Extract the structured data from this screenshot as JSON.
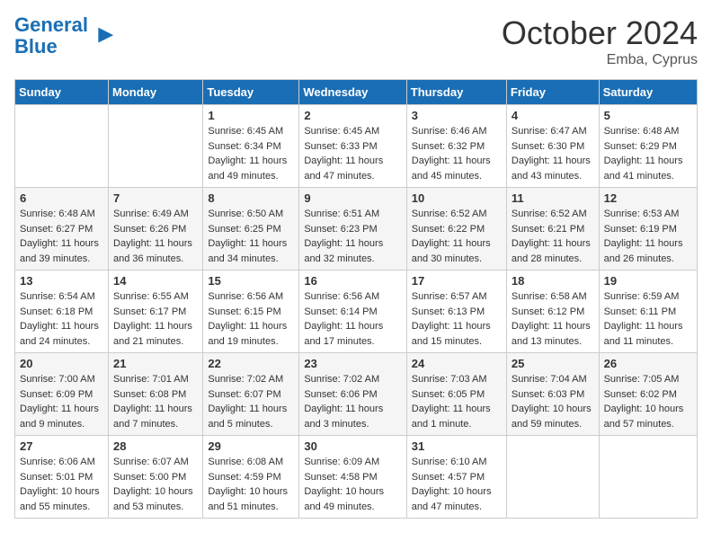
{
  "logo": {
    "line1": "General",
    "line2": "Blue"
  },
  "title": "October 2024",
  "location": "Emba, Cyprus",
  "days_of_week": [
    "Sunday",
    "Monday",
    "Tuesday",
    "Wednesday",
    "Thursday",
    "Friday",
    "Saturday"
  ],
  "weeks": [
    [
      {
        "day": "",
        "info": ""
      },
      {
        "day": "",
        "info": ""
      },
      {
        "day": "1",
        "sunrise": "6:45 AM",
        "sunset": "6:34 PM",
        "daylight": "11 hours and 49 minutes."
      },
      {
        "day": "2",
        "sunrise": "6:45 AM",
        "sunset": "6:33 PM",
        "daylight": "11 hours and 47 minutes."
      },
      {
        "day": "3",
        "sunrise": "6:46 AM",
        "sunset": "6:32 PM",
        "daylight": "11 hours and 45 minutes."
      },
      {
        "day": "4",
        "sunrise": "6:47 AM",
        "sunset": "6:30 PM",
        "daylight": "11 hours and 43 minutes."
      },
      {
        "day": "5",
        "sunrise": "6:48 AM",
        "sunset": "6:29 PM",
        "daylight": "11 hours and 41 minutes."
      }
    ],
    [
      {
        "day": "6",
        "sunrise": "6:48 AM",
        "sunset": "6:27 PM",
        "daylight": "11 hours and 39 minutes."
      },
      {
        "day": "7",
        "sunrise": "6:49 AM",
        "sunset": "6:26 PM",
        "daylight": "11 hours and 36 minutes."
      },
      {
        "day": "8",
        "sunrise": "6:50 AM",
        "sunset": "6:25 PM",
        "daylight": "11 hours and 34 minutes."
      },
      {
        "day": "9",
        "sunrise": "6:51 AM",
        "sunset": "6:23 PM",
        "daylight": "11 hours and 32 minutes."
      },
      {
        "day": "10",
        "sunrise": "6:52 AM",
        "sunset": "6:22 PM",
        "daylight": "11 hours and 30 minutes."
      },
      {
        "day": "11",
        "sunrise": "6:52 AM",
        "sunset": "6:21 PM",
        "daylight": "11 hours and 28 minutes."
      },
      {
        "day": "12",
        "sunrise": "6:53 AM",
        "sunset": "6:19 PM",
        "daylight": "11 hours and 26 minutes."
      }
    ],
    [
      {
        "day": "13",
        "sunrise": "6:54 AM",
        "sunset": "6:18 PM",
        "daylight": "11 hours and 24 minutes."
      },
      {
        "day": "14",
        "sunrise": "6:55 AM",
        "sunset": "6:17 PM",
        "daylight": "11 hours and 21 minutes."
      },
      {
        "day": "15",
        "sunrise": "6:56 AM",
        "sunset": "6:15 PM",
        "daylight": "11 hours and 19 minutes."
      },
      {
        "day": "16",
        "sunrise": "6:56 AM",
        "sunset": "6:14 PM",
        "daylight": "11 hours and 17 minutes."
      },
      {
        "day": "17",
        "sunrise": "6:57 AM",
        "sunset": "6:13 PM",
        "daylight": "11 hours and 15 minutes."
      },
      {
        "day": "18",
        "sunrise": "6:58 AM",
        "sunset": "6:12 PM",
        "daylight": "11 hours and 13 minutes."
      },
      {
        "day": "19",
        "sunrise": "6:59 AM",
        "sunset": "6:11 PM",
        "daylight": "11 hours and 11 minutes."
      }
    ],
    [
      {
        "day": "20",
        "sunrise": "7:00 AM",
        "sunset": "6:09 PM",
        "daylight": "11 hours and 9 minutes."
      },
      {
        "day": "21",
        "sunrise": "7:01 AM",
        "sunset": "6:08 PM",
        "daylight": "11 hours and 7 minutes."
      },
      {
        "day": "22",
        "sunrise": "7:02 AM",
        "sunset": "6:07 PM",
        "daylight": "11 hours and 5 minutes."
      },
      {
        "day": "23",
        "sunrise": "7:02 AM",
        "sunset": "6:06 PM",
        "daylight": "11 hours and 3 minutes."
      },
      {
        "day": "24",
        "sunrise": "7:03 AM",
        "sunset": "6:05 PM",
        "daylight": "11 hours and 1 minute."
      },
      {
        "day": "25",
        "sunrise": "7:04 AM",
        "sunset": "6:03 PM",
        "daylight": "10 hours and 59 minutes."
      },
      {
        "day": "26",
        "sunrise": "7:05 AM",
        "sunset": "6:02 PM",
        "daylight": "10 hours and 57 minutes."
      }
    ],
    [
      {
        "day": "27",
        "sunrise": "6:06 AM",
        "sunset": "5:01 PM",
        "daylight": "10 hours and 55 minutes."
      },
      {
        "day": "28",
        "sunrise": "6:07 AM",
        "sunset": "5:00 PM",
        "daylight": "10 hours and 53 minutes."
      },
      {
        "day": "29",
        "sunrise": "6:08 AM",
        "sunset": "4:59 PM",
        "daylight": "10 hours and 51 minutes."
      },
      {
        "day": "30",
        "sunrise": "6:09 AM",
        "sunset": "4:58 PM",
        "daylight": "10 hours and 49 minutes."
      },
      {
        "day": "31",
        "sunrise": "6:10 AM",
        "sunset": "4:57 PM",
        "daylight": "10 hours and 47 minutes."
      },
      {
        "day": "",
        "info": ""
      },
      {
        "day": "",
        "info": ""
      }
    ]
  ]
}
